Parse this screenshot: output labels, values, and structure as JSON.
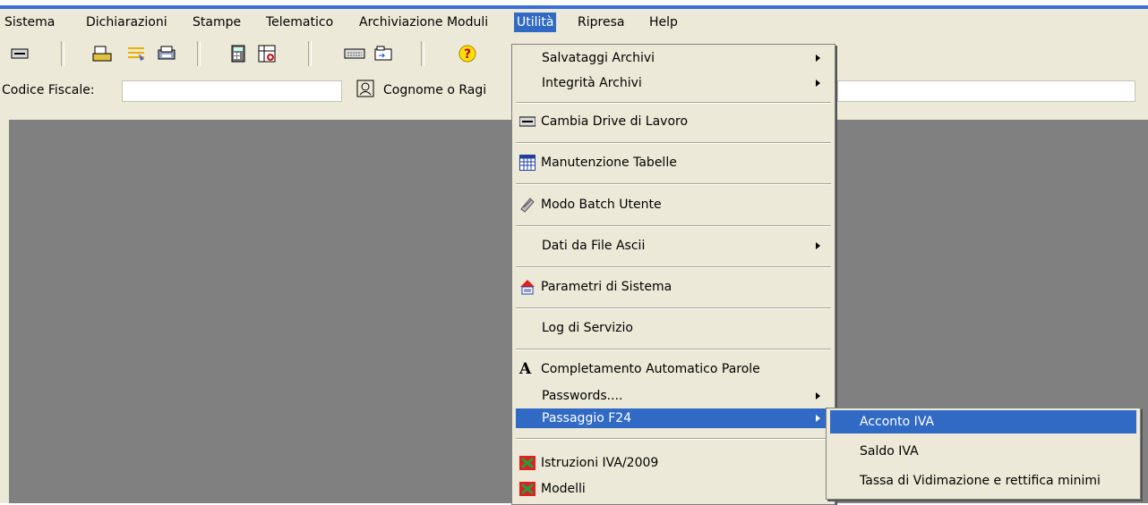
{
  "menubar": {
    "items": [
      "Sistema",
      "Dichiarazioni",
      "Stampe",
      "Telematico",
      "Archiviazione Moduli",
      "Utilità",
      "Ripresa",
      "Help"
    ]
  },
  "toolbar": {
    "icons": [
      "drive-icon",
      "print-icon",
      "notes-icon",
      "printer-setup-icon",
      "calculator-icon",
      "grid-plus-icon",
      "keyboard-icon",
      "folder-icon",
      "help-icon"
    ]
  },
  "search": {
    "codice_label": "Codice Fiscale:",
    "cognome_label": "Cognome o Ragi"
  },
  "utilita_menu": {
    "salvataggi": "Salvataggi Archivi",
    "integrita": "Integrità Archivi",
    "cambia_drive": "Cambia Drive di Lavoro",
    "manutenzione": "Manutenzione Tabelle",
    "modo_batch": "Modo Batch Utente",
    "dati_ascii": "Dati da File Ascii",
    "parametri": "Parametri di Sistema",
    "log": "Log di Servizio",
    "completamento": "Completamento Automatico Parole",
    "passwords": "Passwords....",
    "passaggio": "Passaggio F24",
    "istruzioni": "Istruzioni IVA/2009",
    "modelli": "Modelli"
  },
  "submenu_f24": {
    "acconto": "Acconto IVA",
    "saldo": "Saldo IVA",
    "tassa": "Tassa di Vidimazione e rettifica minimi"
  },
  "colors": {
    "highlight": "#316ac5",
    "chrome": "#ece9d8",
    "workspace": "#808080"
  }
}
